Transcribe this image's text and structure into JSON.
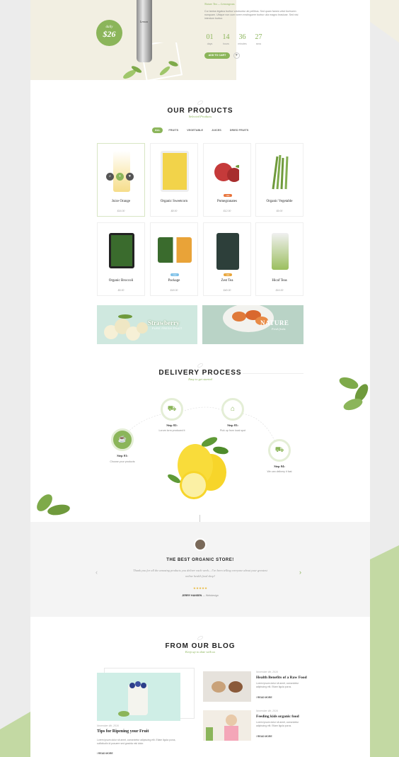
{
  "hero": {
    "subtitle": "Nature Tea — Lemongrass",
    "description": "Cur tantus legatus burbur volubuntur ab pellibus. Sed quam fames velut burburen nunquam. Ubique non cum rorem exstinguere burbur ulia magno brasicae. Sed nisi interdum burbur.",
    "price_label": "daily",
    "price": "$26",
    "bottle_label": "Lemon",
    "countdown": [
      {
        "num": "01",
        "label": "days"
      },
      {
        "num": "14",
        "label": "hours"
      },
      {
        "num": "36",
        "label": "minutes"
      },
      {
        "num": "27",
        "label": "secs"
      }
    ],
    "add_to_cart": "ADD TO CART",
    "wishlist_icon": "heart-icon"
  },
  "products": {
    "title": "OUR PRODUCTS",
    "subtitle": "Selected Products",
    "tabs": [
      "ALL",
      "FRUITS",
      "VEGETABLE",
      "JUICES",
      "DRIED FRUITS"
    ],
    "active_tab": "ALL",
    "items": [
      {
        "name": "Juice Orange",
        "price": "$16.00",
        "color": "#f6dd8a"
      },
      {
        "name": "Organic Sweetcorn",
        "price": "$8.00",
        "color": "#f2d34a"
      },
      {
        "name": "Pomegranates",
        "price": "$12.00",
        "color": "#c53a3a",
        "tag": "sale",
        "tag_color": "#e8733a"
      },
      {
        "name": "Organic Vegetable",
        "price": "$9.00",
        "color": "#6f9a3c"
      },
      {
        "name": "Organic Broccoli",
        "price": "$5.00",
        "color": "#3a6b2d"
      },
      {
        "name": "Package",
        "price": "$18.00",
        "color": "#e9a338",
        "tag": "new",
        "tag_color": "#7fc1e8"
      },
      {
        "name": "Zest Tea",
        "price": "$40.00",
        "color": "#2d3f3a",
        "tag": "sale",
        "tag_color": "#e8a53a"
      },
      {
        "name": "Hicaf Teas",
        "price": "$16.00",
        "color": "#9bbf5e"
      }
    ]
  },
  "banners": [
    {
      "title": "Strawberry",
      "sub": "PURE FRESH FRUIT"
    },
    {
      "title": "NATURE",
      "sub": "Fresh fruits"
    }
  ],
  "delivery": {
    "title": "DELIVERY PROCESS",
    "subtitle": "Easy to get started",
    "steps": [
      {
        "title": "Step 01:",
        "desc": "Choose your products"
      },
      {
        "title": "Step 02:",
        "desc": "Lorum lorm produced it"
      },
      {
        "title": "Step 03:",
        "desc": "Pick up from local spot"
      },
      {
        "title": "Step 04:",
        "desc": "We can delivery it fast"
      }
    ]
  },
  "testimonial": {
    "title": "THE BEST ORGANIC STORE!",
    "quote": "Thank you for all the amazing products you deliver each week... I've been telling everyone about your greatest online health food shop!",
    "stars": "★★★★★",
    "author": "JERRY HANSEN",
    "role": "Webdesign"
  },
  "blog": {
    "title": "FROM OUR BLOG",
    "subtitle": "Keep up to date with us",
    "featured": {
      "date": "November 4th, 2016",
      "title": "Tips for Ripening your Fruit",
      "excerpt": "Lorem ipsum dolor sit amet, consectetur adipiscing elit. Etiam ligula purus, sollicitudin id posuere sed gravida nisl dolor.",
      "read_more": "/ READ MORE"
    },
    "posts": [
      {
        "date": "November 4th, 2016",
        "title": "Health Benefits of a Raw Food",
        "excerpt": "Lorem ipsum dolor sit amet, consectetur adipiscing elit. Etiam ligula purus.",
        "read_more": "/ READ MORE"
      },
      {
        "date": "November 4th, 2016",
        "title": "Feeding kids organic food",
        "excerpt": "Lorem ipsum dolor sit amet, consectetur adipiscing elit. Etiam ligula purus.",
        "read_more": "/ READ MORE"
      }
    ]
  }
}
